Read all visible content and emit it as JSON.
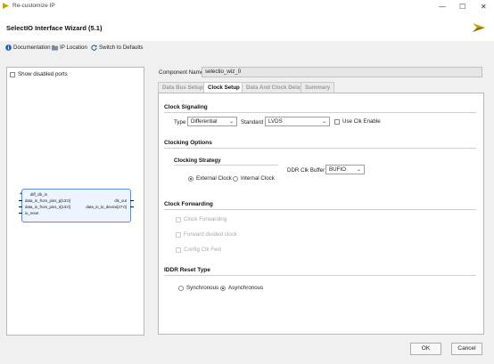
{
  "window": {
    "title": "Re-customize IP",
    "minimize": "—",
    "maximize": "☐",
    "close": "✕"
  },
  "wizard": {
    "title": "SelectIO Interface Wizard (5.1)"
  },
  "toolbar": {
    "documentation": "Documentation",
    "ip_location": "IP Location",
    "switch_defaults": "Switch to Defaults"
  },
  "left_panel": {
    "show_disabled_ports": "Show disabled ports",
    "symbol": {
      "inputs": [
        "diff_clk_in",
        "data_in_from_pins_p[13:0]",
        "data_in_from_pins_n[13:0]",
        "io_reset"
      ],
      "outputs": [
        "clk_out",
        "data_in_to_device[27:0]"
      ]
    }
  },
  "component": {
    "label": "Component Name",
    "value": "selectio_wiz_0"
  },
  "tabs": [
    "Data Bus Setup",
    "Clock Setup",
    "Data And Clock Delay",
    "Summary"
  ],
  "clock_signaling": {
    "heading": "Clock Signaling",
    "type_label": "Type",
    "type_value": "Differential",
    "standard_label": "Standard",
    "standard_value": "LVDS",
    "use_clk_enable": "Use Clk Enable"
  },
  "clocking_options": {
    "heading": "Clocking Options",
    "strategy_heading": "Clocking Strategy",
    "external_clock": "External Clock",
    "internal_clock": "Internal Clock",
    "ddr_clk_buffer_label": "DDR Clk Buffer",
    "ddr_clk_buffer_value": "BUFIO"
  },
  "clock_forwarding": {
    "heading": "Clock Forwarding",
    "clock_forwarding": "Clock Forwarding",
    "forward_divided_clock": "Forward divided clock",
    "config_clk_fwd": "Config Clk Fwd"
  },
  "iddr_reset": {
    "heading": "IDDR Reset Type",
    "synchronous": "Synchronous",
    "asynchronous": "Asynchronous"
  },
  "buttons": {
    "ok": "OK",
    "cancel": "Cancel"
  },
  "colors": {
    "accent_logo": "#c8a400",
    "link_blue": "#1f5fb4",
    "symbol_border": "#5b8fd6",
    "symbol_fill": "#eef4ff"
  }
}
